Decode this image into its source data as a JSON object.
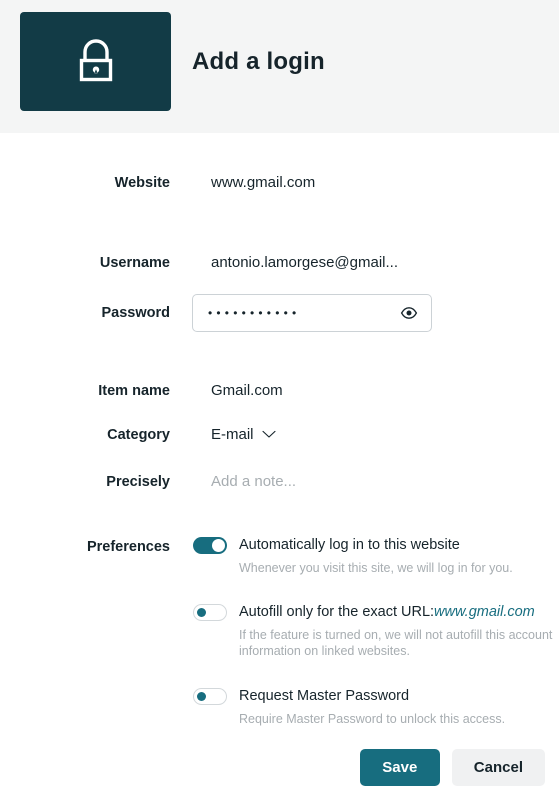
{
  "header": {
    "title": "Add a login",
    "icon": "lock-icon",
    "icon_box_color": "#123b46",
    "band_color": "#f4f5f5"
  },
  "theme": {
    "accent": "#176d7f",
    "text": "#16242b",
    "muted": "#a7adb1",
    "border": "#ccd2d6"
  },
  "fields": {
    "website": {
      "label": "Website",
      "value": "www.gmail.com"
    },
    "username": {
      "label": "Username",
      "value": "antonio.lamorgese@gmail..."
    },
    "password": {
      "label": "Password",
      "value": "...........",
      "masked": true,
      "dot_count": 11,
      "reveal_icon": "eye-icon"
    },
    "item_name": {
      "label": "Item name",
      "value": "Gmail.com"
    },
    "category": {
      "label": "Category",
      "value": "E-mail",
      "chevron": "chevron-down-icon"
    },
    "note": {
      "label": "Precisely",
      "placeholder": "Add a note...",
      "value": ""
    }
  },
  "preferences": {
    "label": "Preferences",
    "items": [
      {
        "title": "Automatically log in to this website",
        "description": "Whenever you visit this site, we will log in for you.",
        "enabled": true
      },
      {
        "title": "Autofill only for the exact URL:",
        "url": "www.gmail.com",
        "description": "If the feature is turned on, we will not autofill this account information on linked websites.",
        "enabled": false
      },
      {
        "title": "Request Master Password",
        "description": "Require Master Password to unlock this access.",
        "enabled": false
      }
    ]
  },
  "actions": {
    "save_label": "Save",
    "cancel_label": "Cancel"
  }
}
